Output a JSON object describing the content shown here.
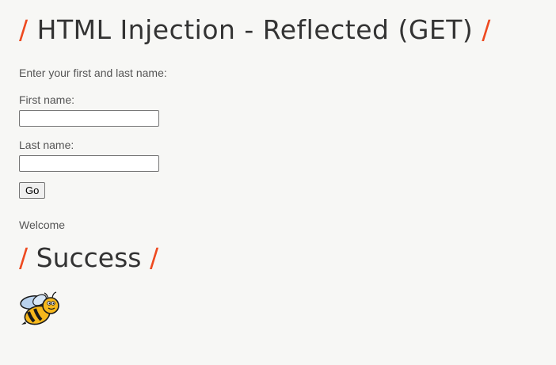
{
  "header": {
    "slash_left": "/",
    "title": "HTML Injection - Reflected (GET)",
    "slash_right": "/"
  },
  "form": {
    "intro": "Enter your first and last name:",
    "first_name_label": "First name:",
    "first_name_value": "",
    "last_name_label": "Last name:",
    "last_name_value": "",
    "go_label": "Go"
  },
  "result": {
    "welcome": "Welcome",
    "slash_left": "/",
    "success": "Success",
    "slash_right": "/"
  },
  "icons": {
    "bee": "bee-icon"
  },
  "colors": {
    "accent": "#ee4a20",
    "heading": "#333333",
    "text": "#555555",
    "background": "#f7f7f5"
  }
}
